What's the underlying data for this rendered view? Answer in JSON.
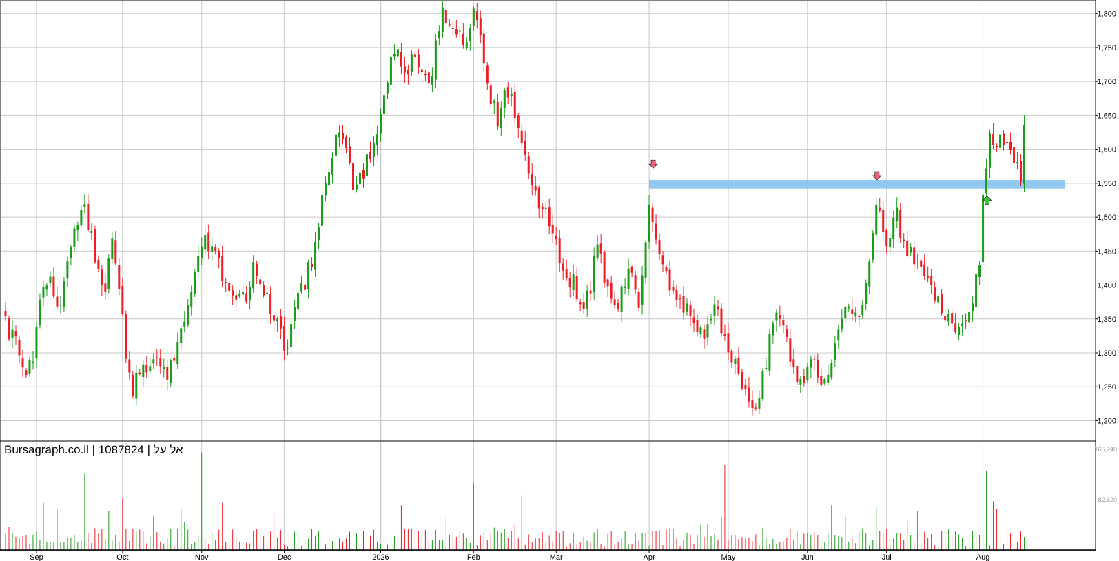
{
  "colors": {
    "up": "#1a9b1a",
    "down": "#ee1c24",
    "grid": "#c8c8c8",
    "frame": "#7f7f7f",
    "zone": "#7fbff0",
    "marker_down": "#f06078",
    "marker_up": "#33cc33"
  },
  "chart_data": {
    "type": "candlestick",
    "title": "Bursagraph.co.il | 1087824 | אל על",
    "ylim": [
      1170,
      1820
    ],
    "yticks": [
      "1,800",
      "1,750",
      "1,700",
      "1,650",
      "1,600",
      "1,550",
      "1,500",
      "1,450",
      "1,400",
      "1,350",
      "1,300",
      "1,250",
      "1,200"
    ],
    "ytick_values": [
      1800,
      1750,
      1700,
      1650,
      1600,
      1550,
      1500,
      1450,
      1400,
      1350,
      1300,
      1250,
      1200
    ],
    "volume_ylim": [
      0,
      165240
    ],
    "volume_ticks": [
      "165,240",
      "82,620"
    ],
    "volume_tick_values": [
      165240,
      82620
    ],
    "xtick_labels": [
      "Sep",
      "Oct",
      "Nov",
      "Dec",
      "2026",
      "Feb",
      "Mar",
      "Apr",
      "May",
      "Jun",
      "Jul",
      "Aug"
    ],
    "xtick_index": [
      9,
      34,
      57,
      81,
      109,
      136,
      160,
      187,
      210,
      233,
      256,
      284
    ],
    "resistance_zone": {
      "low": 1542,
      "high": 1555,
      "from_index": 187
    },
    "markers": [
      {
        "type": "sell",
        "index": 187,
        "value": 1575
      },
      {
        "type": "sell",
        "index": 252,
        "value": 1558
      },
      {
        "type": "buy",
        "index": 284,
        "value": 1528
      }
    ],
    "anchors": [
      {
        "i": 0,
        "c": 1345
      },
      {
        "i": 4,
        "c": 1300
      },
      {
        "i": 6,
        "c": 1260
      },
      {
        "i": 8,
        "c": 1300
      },
      {
        "i": 10,
        "c": 1380
      },
      {
        "i": 13,
        "c": 1400
      },
      {
        "i": 16,
        "c": 1370
      },
      {
        "i": 19,
        "c": 1470
      },
      {
        "i": 23,
        "c": 1520
      },
      {
        "i": 26,
        "c": 1440
      },
      {
        "i": 29,
        "c": 1400
      },
      {
        "i": 31,
        "c": 1460
      },
      {
        "i": 33,
        "c": 1390
      },
      {
        "i": 35,
        "c": 1300
      },
      {
        "i": 37,
        "c": 1250
      },
      {
        "i": 42,
        "c": 1290
      },
      {
        "i": 47,
        "c": 1270
      },
      {
        "i": 50,
        "c": 1310
      },
      {
        "i": 54,
        "c": 1400
      },
      {
        "i": 58,
        "c": 1470
      },
      {
        "i": 61,
        "c": 1450
      },
      {
        "i": 63,
        "c": 1410
      },
      {
        "i": 67,
        "c": 1370
      },
      {
        "i": 70,
        "c": 1380
      },
      {
        "i": 72,
        "c": 1420
      },
      {
        "i": 75,
        "c": 1390
      },
      {
        "i": 78,
        "c": 1350
      },
      {
        "i": 82,
        "c": 1300
      },
      {
        "i": 84,
        "c": 1370
      },
      {
        "i": 87,
        "c": 1400
      },
      {
        "i": 90,
        "c": 1460
      },
      {
        "i": 93,
        "c": 1560
      },
      {
        "i": 97,
        "c": 1630
      },
      {
        "i": 99,
        "c": 1600
      },
      {
        "i": 101,
        "c": 1540
      },
      {
        "i": 104,
        "c": 1570
      },
      {
        "i": 106,
        "c": 1600
      },
      {
        "i": 109,
        "c": 1640
      },
      {
        "i": 113,
        "c": 1750
      },
      {
        "i": 116,
        "c": 1710
      },
      {
        "i": 119,
        "c": 1750
      },
      {
        "i": 122,
        "c": 1700
      },
      {
        "i": 124,
        "c": 1720
      },
      {
        "i": 127,
        "c": 1800
      },
      {
        "i": 130,
        "c": 1780
      },
      {
        "i": 134,
        "c": 1760
      },
      {
        "i": 136,
        "c": 1800
      },
      {
        "i": 139,
        "c": 1740
      },
      {
        "i": 141,
        "c": 1680
      },
      {
        "i": 143,
        "c": 1640
      },
      {
        "i": 146,
        "c": 1690
      },
      {
        "i": 149,
        "c": 1640
      },
      {
        "i": 152,
        "c": 1560
      },
      {
        "i": 155,
        "c": 1520
      },
      {
        "i": 158,
        "c": 1500
      },
      {
        "i": 161,
        "c": 1440
      },
      {
        "i": 163,
        "c": 1400
      },
      {
        "i": 165,
        "c": 1420
      },
      {
        "i": 167,
        "c": 1360
      },
      {
        "i": 170,
        "c": 1400
      },
      {
        "i": 172,
        "c": 1460
      },
      {
        "i": 175,
        "c": 1390
      },
      {
        "i": 178,
        "c": 1370
      },
      {
        "i": 180,
        "c": 1400
      },
      {
        "i": 182,
        "c": 1430
      },
      {
        "i": 184,
        "c": 1360
      },
      {
        "i": 186,
        "c": 1460
      },
      {
        "i": 187,
        "c": 1530
      },
      {
        "i": 189,
        "c": 1460
      },
      {
        "i": 191,
        "c": 1420
      },
      {
        "i": 194,
        "c": 1390
      },
      {
        "i": 197,
        "c": 1370
      },
      {
        "i": 200,
        "c": 1340
      },
      {
        "i": 203,
        "c": 1320
      },
      {
        "i": 206,
        "c": 1370
      },
      {
        "i": 209,
        "c": 1320
      },
      {
        "i": 212,
        "c": 1280
      },
      {
        "i": 215,
        "c": 1240
      },
      {
        "i": 218,
        "c": 1210
      },
      {
        "i": 220,
        "c": 1260
      },
      {
        "i": 223,
        "c": 1350
      },
      {
        "i": 226,
        "c": 1340
      },
      {
        "i": 229,
        "c": 1280
      },
      {
        "i": 232,
        "c": 1250
      },
      {
        "i": 234,
        "c": 1300
      },
      {
        "i": 237,
        "c": 1260
      },
      {
        "i": 239,
        "c": 1280
      },
      {
        "i": 242,
        "c": 1320
      },
      {
        "i": 245,
        "c": 1370
      },
      {
        "i": 248,
        "c": 1360
      },
      {
        "i": 251,
        "c": 1430
      },
      {
        "i": 253,
        "c": 1520
      },
      {
        "i": 256,
        "c": 1470
      },
      {
        "i": 259,
        "c": 1500
      },
      {
        "i": 261,
        "c": 1460
      },
      {
        "i": 264,
        "c": 1440
      },
      {
        "i": 266,
        "c": 1420
      },
      {
        "i": 269,
        "c": 1390
      },
      {
        "i": 272,
        "c": 1370
      },
      {
        "i": 275,
        "c": 1340
      },
      {
        "i": 277,
        "c": 1340
      },
      {
        "i": 280,
        "c": 1350
      },
      {
        "i": 282,
        "c": 1420
      },
      {
        "i": 283,
        "c": 1420
      },
      {
        "i": 284,
        "c": 1540
      },
      {
        "i": 286,
        "c": 1610
      },
      {
        "i": 289,
        "c": 1620
      },
      {
        "i": 292,
        "c": 1600
      },
      {
        "i": 294,
        "c": 1580
      },
      {
        "i": 295,
        "c": 1565
      },
      {
        "i": 296,
        "c": 1645
      }
    ],
    "n_candles": 297
  }
}
